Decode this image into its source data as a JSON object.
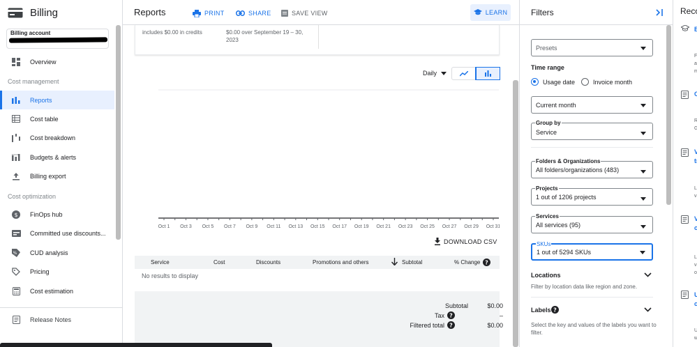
{
  "app": {
    "title": "Billing"
  },
  "account": {
    "label": "Billing account"
  },
  "nav": {
    "overview": "Overview",
    "section_cost_management": "Cost management",
    "cost_management": [
      "Reports",
      "Cost table",
      "Cost breakdown",
      "Budgets & alerts",
      "Billing export"
    ],
    "section_cost_optimization": "Cost optimization",
    "cost_optimization": [
      "FinOps hub",
      "Committed use discounts...",
      "CUD analysis",
      "Pricing",
      "Cost estimation"
    ],
    "release_notes": "Release Notes",
    "active": "Reports"
  },
  "header": {
    "title": "Reports",
    "print": "PRINT",
    "share": "SHARE",
    "save_view": "SAVE VIEW",
    "learn": "LEARN"
  },
  "summary": {
    "credits_note": "includes $0.00 in credits",
    "period_note": "$0.00 over September 19 – 30, 2023"
  },
  "chart_controls": {
    "period": "Daily"
  },
  "chart_data": {
    "type": "bar",
    "categories": [
      "Oct 1",
      "Oct 3",
      "Oct 5",
      "Oct 7",
      "Oct 9",
      "Oct 11",
      "Oct 13",
      "Oct 15",
      "Oct 17",
      "Oct 19",
      "Oct 21",
      "Oct 23",
      "Oct 25",
      "Oct 27",
      "Oct 29",
      "Oct 31"
    ],
    "values": [
      0,
      0,
      0,
      0,
      0,
      0,
      0,
      0,
      0,
      0,
      0,
      0,
      0,
      0,
      0,
      0
    ],
    "title": "",
    "xlabel": "",
    "ylabel": "",
    "grid": true
  },
  "download": {
    "label": "DOWNLOAD CSV"
  },
  "table": {
    "columns": [
      "Service",
      "Cost",
      "Discounts",
      "Promotions and others",
      "Subtotal",
      "% Change"
    ],
    "empty_text": "No results to display"
  },
  "totals": {
    "subtotal_label": "Subtotal",
    "subtotal_value": "$0.00",
    "tax_label": "Tax",
    "tax_value": "–",
    "filtered_label": "Filtered total",
    "filtered_value": "$0.00"
  },
  "filters": {
    "title": "Filters",
    "presets": "Presets",
    "time_range": "Time range",
    "usage_date": "Usage date",
    "invoice_month": "Invoice month",
    "range_value": "Current month",
    "group_by_label": "Group by",
    "group_by_value": "Service",
    "folders_label": "Folders & Organizations",
    "folders_value": "All folders/organizations (483)",
    "projects_label": "Projects",
    "projects_value": "1 out of 1206 projects",
    "services_label": "Services",
    "services_value": "All services (95)",
    "skus_label": "SKUs",
    "skus_value": "1 out of 5294 SKUs",
    "locations": "Locations",
    "locations_desc": "Filter by location data like region and zone.",
    "labels": "Labels",
    "labels_desc": "Select the key and values of the labels you want to filter."
  },
  "recommendations": {
    "title": "Reco",
    "items": [
      "B",
      "C",
      "V",
      "V",
      "U"
    ],
    "items_line2": [
      "",
      "",
      "tr",
      "o",
      "c"
    ],
    "snippets": [
      [
        "F",
        "a",
        "m"
      ],
      [
        "R",
        "G"
      ],
      [
        "L",
        "v"
      ],
      [
        "L",
        "vi",
        "o"
      ],
      [
        "U",
        "w"
      ]
    ]
  },
  "colors": {
    "accent": "#1a73e8",
    "active_bg": "#e8f0fe"
  }
}
